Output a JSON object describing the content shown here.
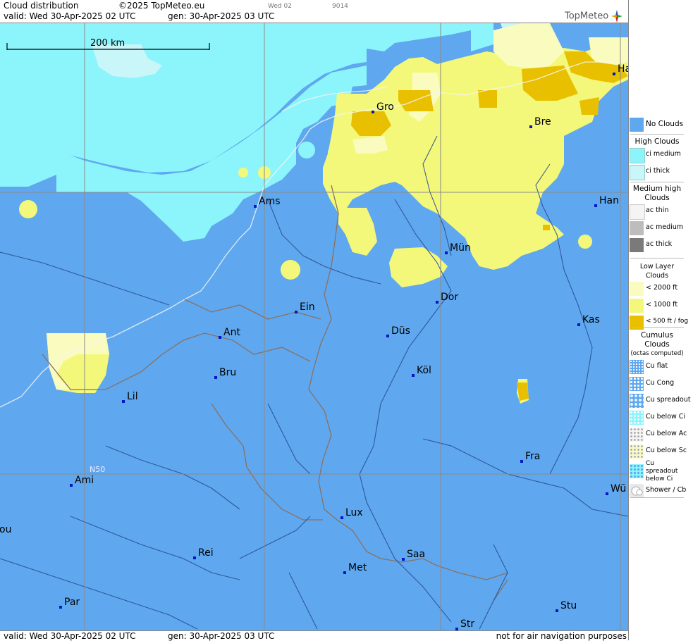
{
  "header": {
    "title": "Cloud distribution",
    "copyright": "©2025 TopMeteo.eu",
    "day_code": "Wed 02",
    "run_code": "9014",
    "valid_line": "valid:  Wed  30-Apr-2025  02 UTC",
    "gen_line": "gen:  30-Apr-2025 03 UTC",
    "logo": "TopMeteo"
  },
  "footer": {
    "valid_line": "valid:  Wed  30-Apr-2025  02 UTC",
    "gen_line": "gen: 30-Apr-2025 03 UTC",
    "disclaimer": "not for air navigation purposes"
  },
  "map": {
    "scale_label": "200 km",
    "grid_label": "N50",
    "colors": {
      "no_clouds": "#5fa8ef",
      "ci_medium": "#8cf5fb",
      "ci_thick": "#c8f6f9",
      "low_2000": "#fafbbf",
      "low_1000": "#f4f87a",
      "low_500": "#e8c000"
    },
    "cities": [
      {
        "name": "Gro"
      },
      {
        "name": "Bre"
      },
      {
        "name": "Ha"
      },
      {
        "name": "Ams"
      },
      {
        "name": "Han"
      },
      {
        "name": "Mün"
      },
      {
        "name": "Dor"
      },
      {
        "name": "Ein"
      },
      {
        "name": "Ant"
      },
      {
        "name": "Düs"
      },
      {
        "name": "Kas"
      },
      {
        "name": "Bru"
      },
      {
        "name": "Köl"
      },
      {
        "name": "Lil"
      },
      {
        "name": "Fra"
      },
      {
        "name": "Ami"
      },
      {
        "name": "Wü"
      },
      {
        "name": "Lux"
      },
      {
        "name": "ou"
      },
      {
        "name": "Rei"
      },
      {
        "name": "Saa"
      },
      {
        "name": "Met"
      },
      {
        "name": "Par"
      },
      {
        "name": "Stu"
      },
      {
        "name": "Str"
      }
    ]
  },
  "legend": {
    "no_clouds": {
      "label": "No Clouds"
    },
    "high": {
      "title": "High Clouds",
      "items": [
        "ci medium",
        "ci thick"
      ]
    },
    "medium": {
      "title": "Medium high Clouds",
      "items": [
        "ac thin",
        "ac medium",
        "ac thick"
      ]
    },
    "low": {
      "title": "Low Layer Clouds",
      "items": [
        "< 2000 ft",
        "< 1000 ft",
        "< 500 ft / fog"
      ]
    },
    "cumulus": {
      "title": "Cumulus Clouds",
      "subtitle": "(octas computed)",
      "items": [
        "Cu flat",
        "Cu Cong",
        "Cu spreadout",
        "Cu below Ci",
        "Cu below Ac",
        "Cu below Sc",
        "Cu spreadout below Ci",
        "Shower / Cb"
      ]
    }
  }
}
